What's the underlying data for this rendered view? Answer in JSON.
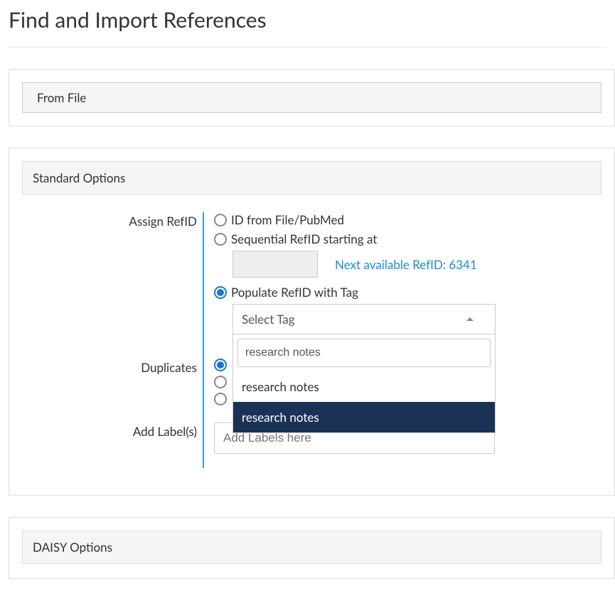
{
  "page": {
    "title": "Find and Import References"
  },
  "source_panel": {
    "mode_label": "From File"
  },
  "standard_options": {
    "header": "Standard Options",
    "assign_refid": {
      "label": "Assign RefID",
      "opt_from_file": "ID from File/PubMed",
      "opt_seq": "Sequential RefID starting at",
      "seq_value": "",
      "next_available": "Next available RefID: 6341",
      "opt_tag": "Populate RefID with Tag",
      "selected": "tag",
      "tag_select": {
        "placeholder": "Select Tag",
        "search_value": "research notes",
        "options": [
          "research notes",
          "research notes"
        ],
        "highlighted_index": 1
      }
    },
    "duplicates": {
      "label": "Duplicates",
      "selected_index": 0,
      "radios": [
        "",
        "",
        ""
      ]
    },
    "add_labels": {
      "label": "Add Label(s)",
      "placeholder": "Add Labels here",
      "value": ""
    }
  },
  "daisy_options": {
    "header": "DAISY Options"
  },
  "icons": {
    "help": "?",
    "warn": "!"
  }
}
